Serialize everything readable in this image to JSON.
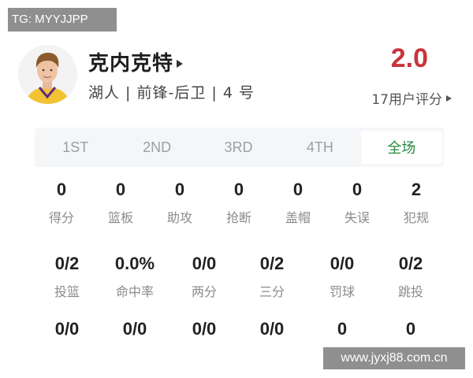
{
  "watermark_top": "TG: MYYJJPP",
  "watermark_bottom": "www.jyxj88.com.cn",
  "player": {
    "name": "克内克特",
    "info": "湖人 | 前锋-后卫 | 4 号"
  },
  "rating": {
    "score": "2.0",
    "count_label": "17用户评分"
  },
  "tabs": [
    {
      "label": "1ST"
    },
    {
      "label": "2ND"
    },
    {
      "label": "3RD"
    },
    {
      "label": "4TH"
    },
    {
      "label": "全场",
      "active": true
    }
  ],
  "row1": [
    {
      "value": "0",
      "label": "得分"
    },
    {
      "value": "0",
      "label": "篮板"
    },
    {
      "value": "0",
      "label": "助攻"
    },
    {
      "value": "0",
      "label": "抢断"
    },
    {
      "value": "0",
      "label": "盖帽"
    },
    {
      "value": "0",
      "label": "失误"
    },
    {
      "value": "2",
      "label": "犯规"
    }
  ],
  "row2": [
    {
      "value": "0/2",
      "label": "投篮"
    },
    {
      "value": "0.0%",
      "label": "命中率"
    },
    {
      "value": "0/0",
      "label": "两分"
    },
    {
      "value": "0/2",
      "label": "三分"
    },
    {
      "value": "0/0",
      "label": "罚球"
    },
    {
      "value": "0/2",
      "label": "跳投"
    }
  ],
  "row3": [
    {
      "value": "0/0"
    },
    {
      "value": "0/0"
    },
    {
      "value": "0/0"
    },
    {
      "value": "0/0"
    },
    {
      "value": "0"
    },
    {
      "value": "0"
    }
  ]
}
